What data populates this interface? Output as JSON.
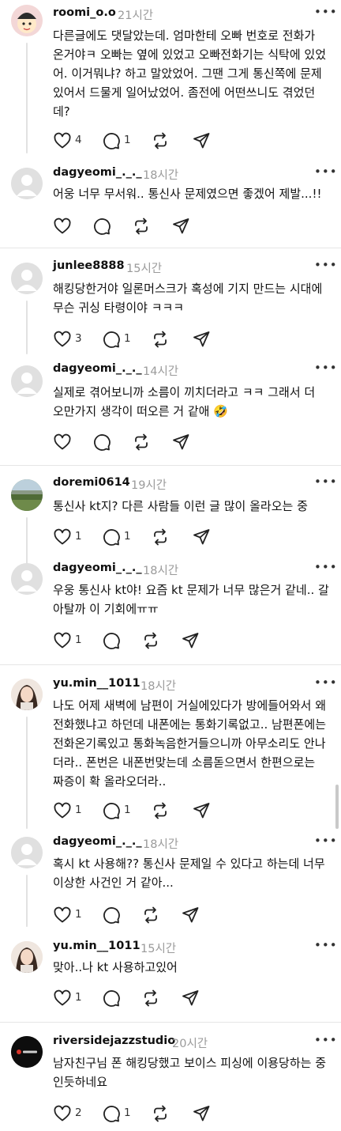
{
  "comments": [
    {
      "username": "roomi_o.o",
      "time": "21시간",
      "text": "다른글에도 댓달았는데. 엄마한테 오빠 번호로 전화가 온거야ㅋ 오빠는 옆에 있었고 오빠전화기는 식탁에 있었어. 이거뭐냐? 하고 말았었어. 그땐 그게 통신쪽에 문제있어서 드물게 일어났었어. 좀전에 어떤쓰니도 겪었던데?",
      "likes": "4",
      "replies": "1"
    },
    {
      "username": "dagyeomi_._._",
      "time": "18시간",
      "text": "어웅 너무 무서워.. 통신사 문제였으면 좋겠어 제발...!!",
      "likes": "",
      "replies": ""
    },
    {
      "username": "junlee8888",
      "time": "15시간",
      "text": "해킹당한거야 일론머스크가 혹성에 기지 만드는 시대에 무슨 귀싱 타령이야 ㅋㅋㅋ",
      "likes": "3",
      "replies": "1"
    },
    {
      "username": "dagyeomi_._._",
      "time": "14시간",
      "text": "실제로 겪어보니까 소름이 끼치더라고 ㅋㅋ 그래서 더 오만가지 생각이 떠오른 거 같애 🤣",
      "likes": "",
      "replies": ""
    },
    {
      "username": "doremi0614",
      "time": "19시간",
      "text": "통신사 kt지? 다른 사람들 이런 글 많이 올라오는 중",
      "likes": "1",
      "replies": "1"
    },
    {
      "username": "dagyeomi_._._",
      "time": "18시간",
      "text": "우웅 통신사 kt야! 요즘 kt 문제가 너무 많은거 같네.. 갈아탈까 이 기회에ㅠㅠ",
      "likes": "1",
      "replies": ""
    },
    {
      "username": "yu.min__1011",
      "time": "18시간",
      "text": "나도 어제 새벽에 남편이 거실에있다가 방에들어와서 왜전화했냐고 하던데 내폰에는 통화기록없고.. 남편폰에는 전화온기록있고 통화녹음한거들으니까 아무소리도 안나더라.. 폰번은 내폰번맞는데 소름돋으면서 한편으로는 짜증이 확 올라오더라..",
      "likes": "1",
      "replies": "1"
    },
    {
      "username": "dagyeomi_._._",
      "time": "18시간",
      "text": "혹시 kt 사용해?? 통신사 문제일 수 있다고 하는데 너무 이상한 사건인 거 같아...",
      "likes": "1",
      "replies": ""
    },
    {
      "username": "yu.min__1011",
      "time": "15시간",
      "text": "맞아..나 kt 사용하고있어",
      "likes": "1",
      "replies": ""
    },
    {
      "username": "riversidejazzstudio",
      "time": "20시간",
      "text": "남자친구님 폰 해킹당했고 보이스 피싱에 이용당하는 중인듯하네요",
      "likes": "2",
      "replies": "1"
    }
  ],
  "icons": {
    "like": "heart-icon",
    "reply": "comment-bubble-icon",
    "repost": "repost-icon",
    "share": "send-icon",
    "more": "more-dots-icon"
  },
  "colors": {
    "text": "#111111",
    "muted": "#9a9a9a",
    "divider": "#e6e6e6"
  }
}
